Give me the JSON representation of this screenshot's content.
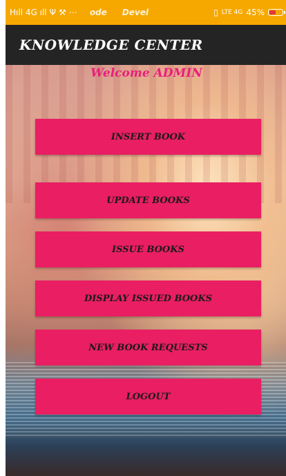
{
  "status_bar": {
    "left_text": "Hıll 4G ıll",
    "mid_1": "ode",
    "mid_2": "Devel",
    "battery": "45%"
  },
  "app_bar": {
    "title": "KNOWLEDGE CENTER"
  },
  "welcome": "Welcome ADMIN",
  "buttons": {
    "insert": "INSERT BOOK",
    "update": "UPDATE BOOKS",
    "issue": "ISSUE BOOKS",
    "display": "DISPLAY ISSUED BOOKS",
    "new_requests": "NEW BOOK REQUESTS",
    "logout": "LOGOUT"
  },
  "colors": {
    "status_bar": "#f6a800",
    "app_bar": "#242424",
    "accent": "#e91e63",
    "welcome": "#e91e7a"
  }
}
